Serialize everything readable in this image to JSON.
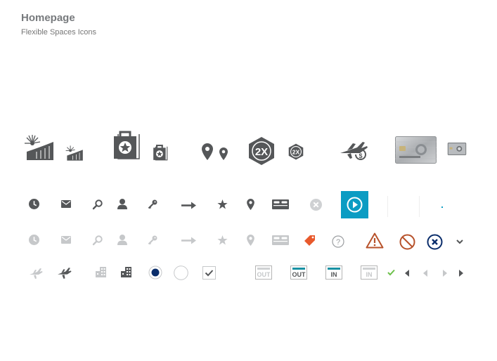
{
  "header": {
    "title": "Homepage",
    "subtitle": "Flexible Spaces Icons"
  },
  "icons": {
    "row1": [
      "sunset-hotel-icon-large",
      "sunset-hotel-icon-small",
      "luggage-star-icon-large",
      "luggage-star-icon-small",
      "map-pin-icon-large",
      "map-pin-icon-small",
      "points-2x-badge-icon-large",
      "points-2x-badge-icon-small",
      "plane-dollar-icon",
      "platinum-card-image-large",
      "platinum-card-image-small"
    ],
    "row2": [
      "clock-icon",
      "mail-icon",
      "search-icon",
      "person-icon",
      "key-icon",
      "arrow-right-icon",
      "star-icon",
      "map-pin-icon",
      "bed-icon",
      "close-circle-icon",
      "play-button"
    ],
    "row3": [
      "clock-icon",
      "mail-icon",
      "search-icon",
      "person-icon",
      "key-icon",
      "arrow-right-icon",
      "star-icon",
      "map-pin-icon",
      "bed-icon",
      "tag-icon",
      "help-icon",
      "warning-icon",
      "prohibited-icon",
      "close-circle-icon",
      "chevron-down-icon"
    ],
    "row4": [
      "plane-icon",
      "plane-icon",
      "buildings-icon",
      "buildings-icon",
      "radio-selected",
      "radio-unselected",
      "checkbox-checked",
      "calendar-out-icon",
      "calendar-in-icon",
      "checkmark-icon",
      "triangle-left-icon",
      "triangle-right-icon"
    ]
  },
  "badges": {
    "points_large": "2X",
    "points_small": "2X"
  },
  "calendar": {
    "out_disabled": "OUT",
    "out_active": "OUT",
    "in_active": "IN",
    "in_disabled": "IN"
  },
  "colors": {
    "dark": "#555759",
    "light": "#c6c8ca",
    "accent_blue": "#0b9cc3",
    "teal": "#1891a3",
    "warning_orange": "#b7522b",
    "tag_orange": "#e8592c",
    "navy": "#0a2d6b",
    "green": "#6cc04a"
  }
}
